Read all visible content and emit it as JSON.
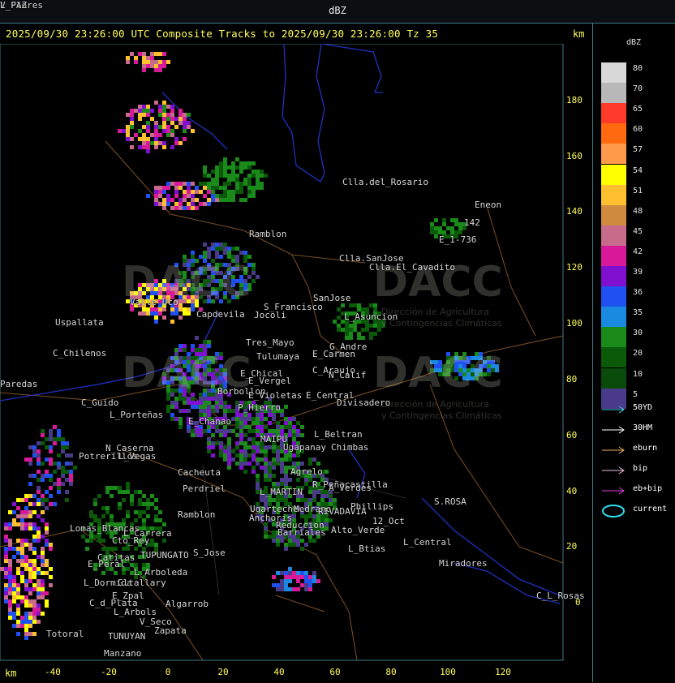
{
  "window": {
    "title": "dBZ"
  },
  "header": {
    "text": "2025/09/30 23:26:00 UTC Composite Tracks to 2025/09/30 23:26:00 Tz 35",
    "km_top": "km",
    "km_bottom": "km"
  },
  "axes": {
    "y_ticks": [
      "180",
      "160",
      "140",
      "120",
      "100",
      "80",
      "60",
      "40",
      "20",
      "0"
    ],
    "x_ticks": [
      "-40",
      "-20",
      "0",
      "20",
      "40",
      "60",
      "80",
      "100",
      "120"
    ]
  },
  "legend": {
    "title": "dBZ",
    "scale": [
      {
        "value": "80",
        "color": "#d8d8d8"
      },
      {
        "value": "70",
        "color": "#b8b8b8"
      },
      {
        "value": "65",
        "color": "#ff3a2a"
      },
      {
        "value": "60",
        "color": "#ff6a10"
      },
      {
        "value": "57",
        "color": "#ff9a4a"
      },
      {
        "value": "54",
        "color": "#ffff00"
      },
      {
        "value": "51",
        "color": "#ffc030"
      },
      {
        "value": "48",
        "color": "#d08a40"
      },
      {
        "value": "45",
        "color": "#c86a8a"
      },
      {
        "value": "42",
        "color": "#d81a9a"
      },
      {
        "value": "39",
        "color": "#8010d0"
      },
      {
        "value": "36",
        "color": "#2050f0"
      },
      {
        "value": "35",
        "color": "#1a8ae0"
      },
      {
        "value": "30",
        "color": "#1a8a1a"
      },
      {
        "value": "20",
        "color": "#0a5a0a"
      },
      {
        "value": "10",
        "color": "#0a4a0a"
      },
      {
        "value": "5",
        "color": "#4a3a8a"
      }
    ],
    "tracks": [
      {
        "label": "50YD",
        "color": "#40d0e0",
        "kind": "arrow"
      },
      {
        "label": "30HM",
        "color": "#ffffff",
        "kind": "arrow"
      },
      {
        "label": "eburn",
        "color": "#f0b060",
        "kind": "arrow"
      },
      {
        "label": "bip",
        "color": "#f0c0d8",
        "kind": "arrow"
      },
      {
        "label": "eb+bip",
        "color": "#e040e0",
        "kind": "arrow"
      },
      {
        "label": "current",
        "color": "#30e0f0",
        "kind": "ellipse"
      }
    ]
  },
  "watermark": {
    "brand": "DACC",
    "subtitle_1": "Dirección de Agricultura",
    "subtitle_2": "y Contingencias Climáticas"
  },
  "places": [
    "Clla.del_Rosario",
    "Eneon",
    "142",
    "E_1-736",
    "Ramblon",
    "Clla.SanJose",
    "Clla.El_Cavadito",
    "S_Francisco",
    "SanJose",
    "Capdevila",
    "Jocoli",
    "L_Asuncion",
    "Uspallata",
    "Valle_Uco",
    "Tres_Mayo",
    "Tulumaya",
    "E_Carmen",
    "G_Andre",
    "C_Chilenos",
    "E_Chical",
    "E_Vergel",
    "C_Araujo",
    "N_Calif",
    "Paredas",
    "Borbollon",
    "E_Violetas",
    "E_Central",
    "Divisadero",
    "C_Guido",
    "P_Hierro",
    "L_Porteñas",
    "E_Chanao",
    "MAIPU",
    "L_Beltran",
    "Ugapanay",
    "Chimbas",
    "N_Caserna",
    "Potrerillos",
    "L_Vegas",
    "Cacheuta",
    "Perdriel",
    "Agrelo",
    "L_MARTIN",
    "R_Peñacastilla",
    "A_Verdes",
    "Ramblon",
    "Ugarteche",
    "Medrano",
    "RIVADAVIA",
    "Phillips",
    "12_Oct",
    "S.ROSA",
    "Lomas_Blancas",
    "L_Carrera",
    "Cto_Rey",
    "S_Jose",
    "Anchoris",
    "Reduccion",
    "Barriales",
    "Alto_Verde",
    "L_Central",
    "Catitas",
    "E_Peral",
    "TUPUNGATO",
    "L_Btias",
    "Miradores",
    "L_Arboleda",
    "L_Dormida",
    "Gltallary",
    "E_Zpal",
    "C_d_Plata",
    "L_Arbols",
    "Algarrob",
    "V_Seco",
    "Zapata",
    "Totoral",
    "TUNUYAN",
    "Manzano",
    "C_L_Rosas",
    "V_Flores",
    "L_PAZ"
  ]
}
